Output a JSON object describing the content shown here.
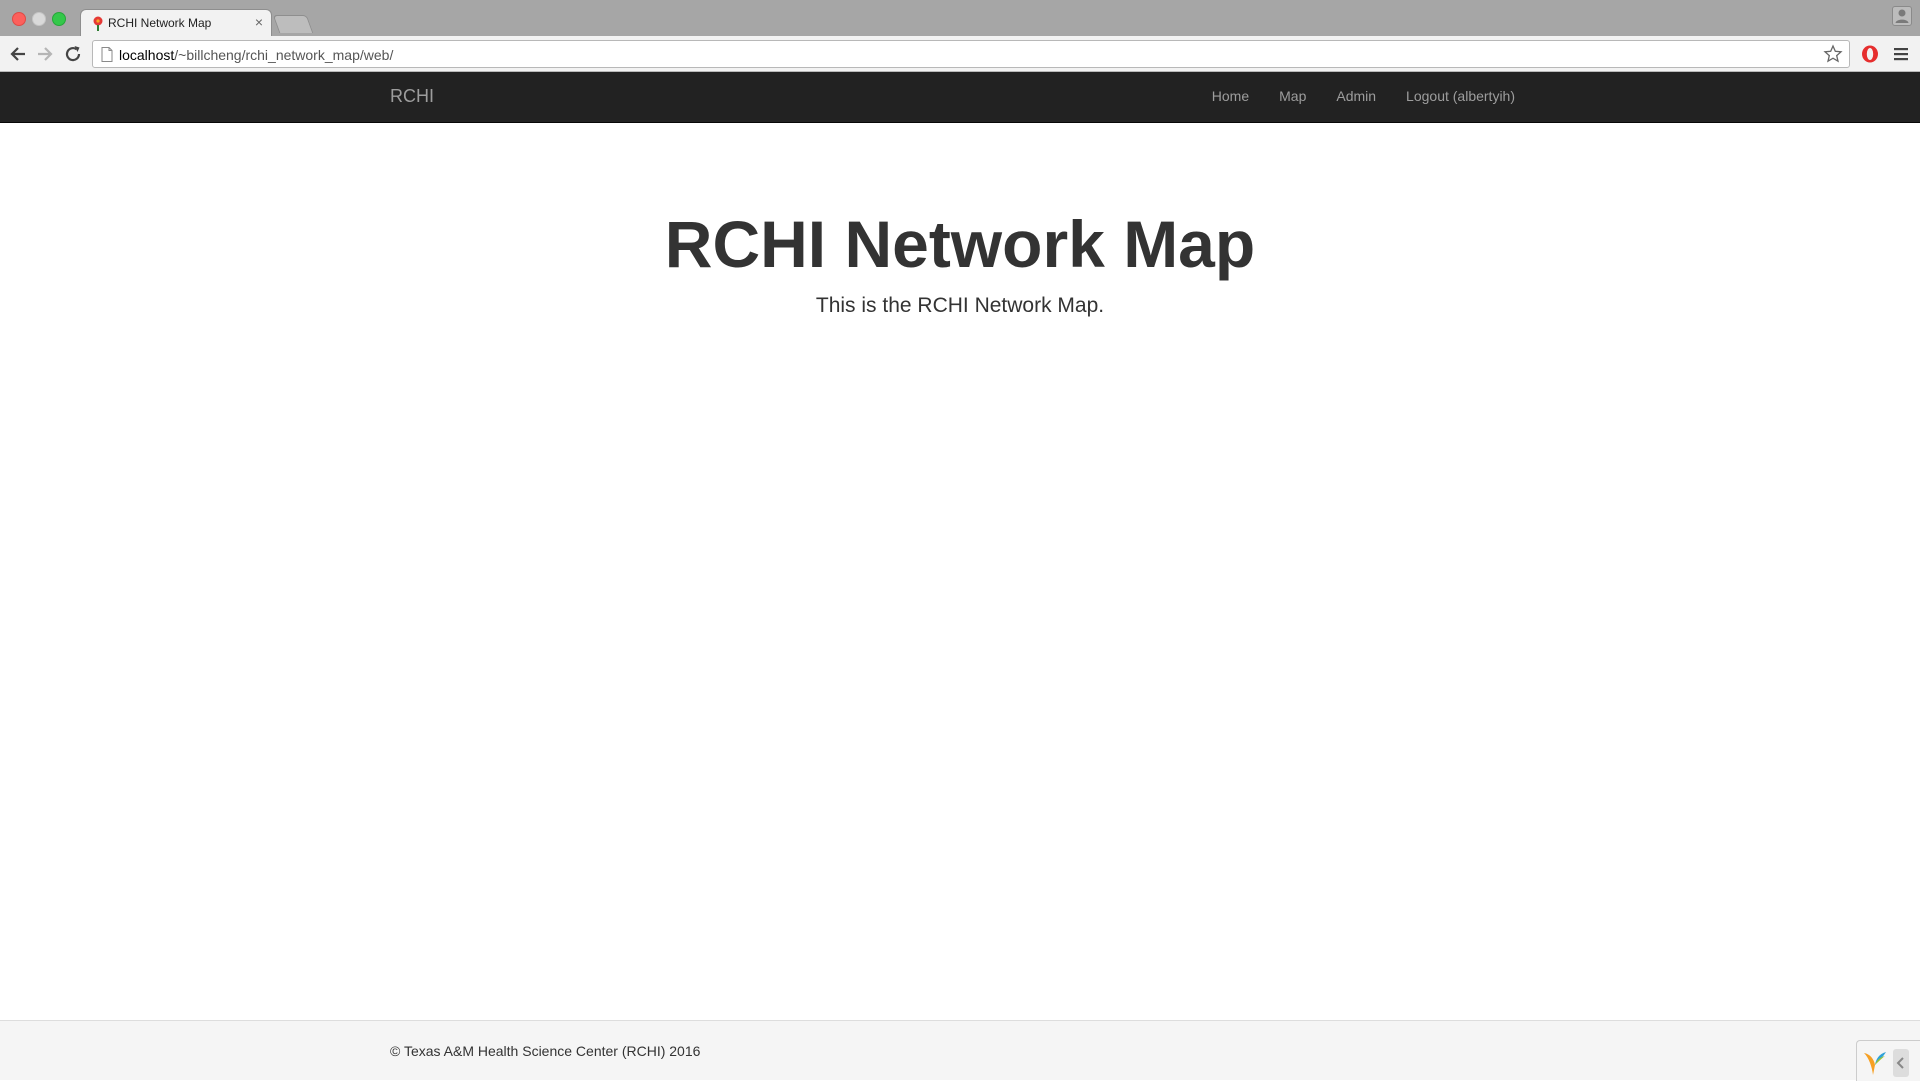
{
  "browser": {
    "tab": {
      "title": "RCHI Network Map",
      "favicon": "pin-icon",
      "close_label": "×"
    },
    "new_tab": "new-tab-icon",
    "address_bar": {
      "url_host": "localhost",
      "url_path": "/~billcheng/rchi_network_map/web/"
    }
  },
  "navbar": {
    "brand": "RCHI",
    "links": [
      {
        "label": "Home"
      },
      {
        "label": "Map"
      },
      {
        "label": "Admin"
      },
      {
        "label": "Logout (albertyih)"
      }
    ],
    "background": "#222222",
    "link_color": "#9d9d9d"
  },
  "main": {
    "title": "RCHI Network Map",
    "lead": "This is the RCHI Network Map."
  },
  "footer": {
    "text": "© Texas A&M Health Science Center (RCHI) 2016",
    "debug_toolbar_icon": "yii-logo-icon"
  }
}
